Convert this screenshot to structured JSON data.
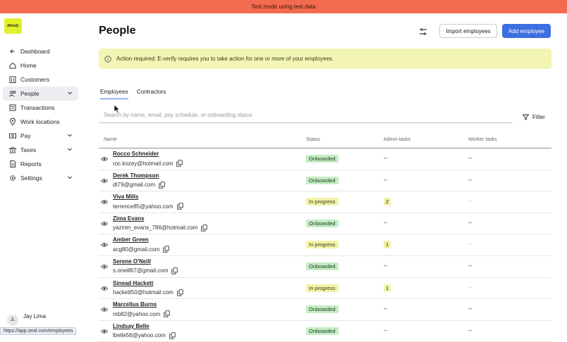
{
  "banner": {
    "text": "Test mode using test data"
  },
  "app": {
    "logo_text": "Illiriofy"
  },
  "sidebar": {
    "items": [
      {
        "label": "Dashboard",
        "icon": "arrow-left-icon"
      },
      {
        "label": "Home",
        "icon": "home-icon"
      },
      {
        "label": "Customers",
        "icon": "building-icon"
      },
      {
        "label": "People",
        "icon": "people-icon",
        "active": true,
        "expandable": true
      },
      {
        "label": "Transactions",
        "icon": "list-icon"
      },
      {
        "label": "Work locations",
        "icon": "map-pin-icon"
      },
      {
        "label": "Pay",
        "icon": "dollar-icon",
        "expandable": true
      },
      {
        "label": "Taxes",
        "icon": "bank-icon",
        "expandable": true
      },
      {
        "label": "Reports",
        "icon": "report-icon"
      },
      {
        "label": "Settings",
        "icon": "gear-icon",
        "expandable": true
      }
    ],
    "user": {
      "initials": "JL",
      "name": "Jay Lima"
    }
  },
  "status_url": "https://app.zeal.com/employees",
  "page": {
    "title": "People",
    "import_button": "Import employees",
    "add_button": "Add employee",
    "alert": "Action required: E-verify requires you to take action for one or more of your employees.",
    "tabs": [
      "Employees",
      "Contractors"
    ],
    "search_placeholder": "Search by name, email, pay schedule, or onboarding status",
    "filter_label": "Filter",
    "columns": [
      "Name",
      "Status",
      "Admin tasks",
      "Worker tasks"
    ]
  },
  "rows": [
    {
      "name": "Rocco Schneider",
      "email": "roc.kozey@hotmail.com",
      "status": "Onboarded",
      "admin": "--",
      "worker": "--"
    },
    {
      "name": "Derek Thompson",
      "email": "dt79@gmail.com",
      "status": "Onboarded",
      "admin": "--",
      "worker": "--"
    },
    {
      "name": "Viva Mills",
      "email": "terrence85@yahoo.com",
      "status": "In progress",
      "admin": "2",
      "worker": "--"
    },
    {
      "name": "Zima Evans",
      "email": "yazmin_evans_786@hotmail.com",
      "status": "Onboarded",
      "admin": "--",
      "worker": "--"
    },
    {
      "name": "Amber Green",
      "email": "acg80@gmail.com",
      "status": "In progress",
      "admin": "1",
      "worker": "--"
    },
    {
      "name": "Serene O'Neill",
      "email": "s.oneill67@gmail.com",
      "status": "Onboarded",
      "admin": "--",
      "worker": "--"
    },
    {
      "name": "Sinead Hackett",
      "email": "hackett50@hotmail.com",
      "status": "In progress",
      "admin": "1",
      "worker": "--"
    },
    {
      "name": "Marcellus Burns",
      "email": "mb82@yahoo.com",
      "status": "Onboarded",
      "admin": "--",
      "worker": "--"
    },
    {
      "name": "Lindsay Belle",
      "email": "lbelle56@yahoo.com",
      "status": "Onboarded",
      "admin": "--",
      "worker": "--"
    }
  ],
  "colors": {
    "accent": "#3c6fe0",
    "banner": "#f26b4f",
    "alert_bg": "#f2f5b3",
    "onboarded": "#c4ecc4",
    "in_progress": "#f1f3a8"
  }
}
